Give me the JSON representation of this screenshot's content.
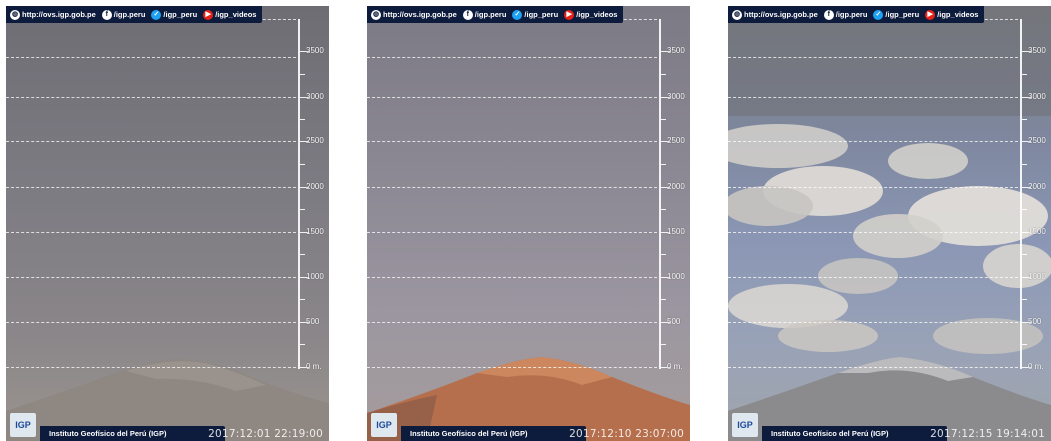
{
  "header_links": {
    "website": "http://ovs.igp.gob.pe",
    "facebook": "/igp.peru",
    "twitter": "/igp_peru",
    "youtube": "/igp_videos"
  },
  "scale_labels": [
    "3500",
    "3000",
    "2500",
    "2000",
    "1500",
    "1000",
    "500",
    "0 m."
  ],
  "footer_label": "Instituto Geofísico del Perú (IGP)",
  "panels": [
    {
      "timestamp": "2017:12:01 22:19:00"
    },
    {
      "timestamp": "2017:12:10 23:07:00"
    },
    {
      "timestamp": "2017:12:15 19:14:01"
    }
  ],
  "colors": {
    "banner": "#0d1b3c",
    "panel1_sky": "#7d7c83",
    "panel2_sky": "#8d8996",
    "panel3_sky": "#7d8aa6",
    "mountain_grey": "#8e8782",
    "mountain_orange": "#c27b54"
  }
}
